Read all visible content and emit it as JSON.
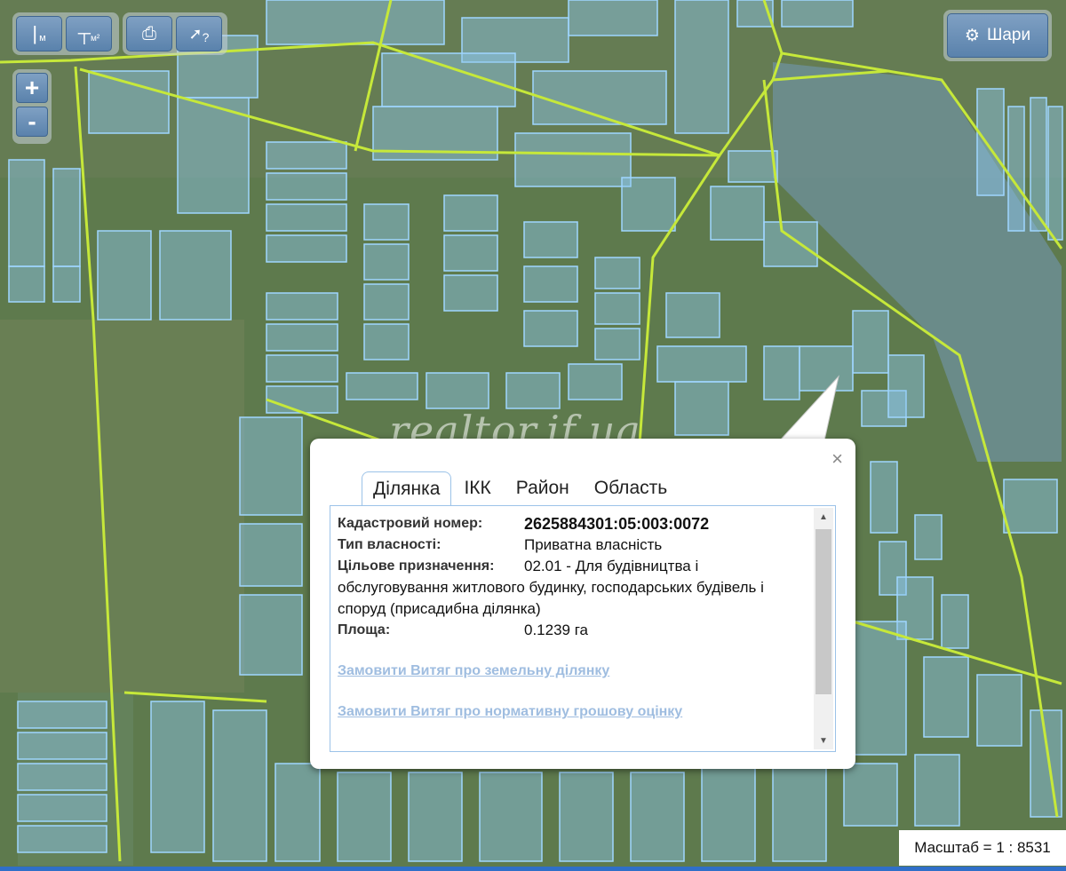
{
  "toolbar": {
    "measure_length_unit": "м",
    "measure_area_unit": "м²",
    "help_mark": "?"
  },
  "zoom": {
    "in_label": "+",
    "out_label": "-"
  },
  "layers": {
    "label": "Шари"
  },
  "watermark": "realtor.if.ua",
  "popup": {
    "tabs": [
      "Ділянка",
      "ІКК",
      "Район",
      "Область"
    ],
    "active_tab": "Ділянка",
    "fields": {
      "cadastral_label": "Кадастровий номер:",
      "cadastral_value": "2625884301:05:003:0072",
      "ownership_label": "Тип власності:",
      "ownership_value": "Приватна власність",
      "purpose_label": "Цільове призначення:",
      "purpose_value_line1": "02.01 - Для будівництва і",
      "purpose_value_rest": "обслуговування житлового будинку, господарських будівель і споруд (присадибна ділянка)",
      "area_label": "Площа:",
      "area_value": "0.1239 га"
    },
    "links": {
      "extract_land": "Замовити Витяг про земельну ділянку",
      "extract_valuation": "Замовити Витяг про нормативну грошову оцінку"
    },
    "close": "×"
  },
  "scale": {
    "text": "Масштаб = 1 : 8531"
  },
  "colors": {
    "parcel": "#8ec8f0",
    "boundary": "#c6e83a",
    "accent": "#5a82ac"
  }
}
